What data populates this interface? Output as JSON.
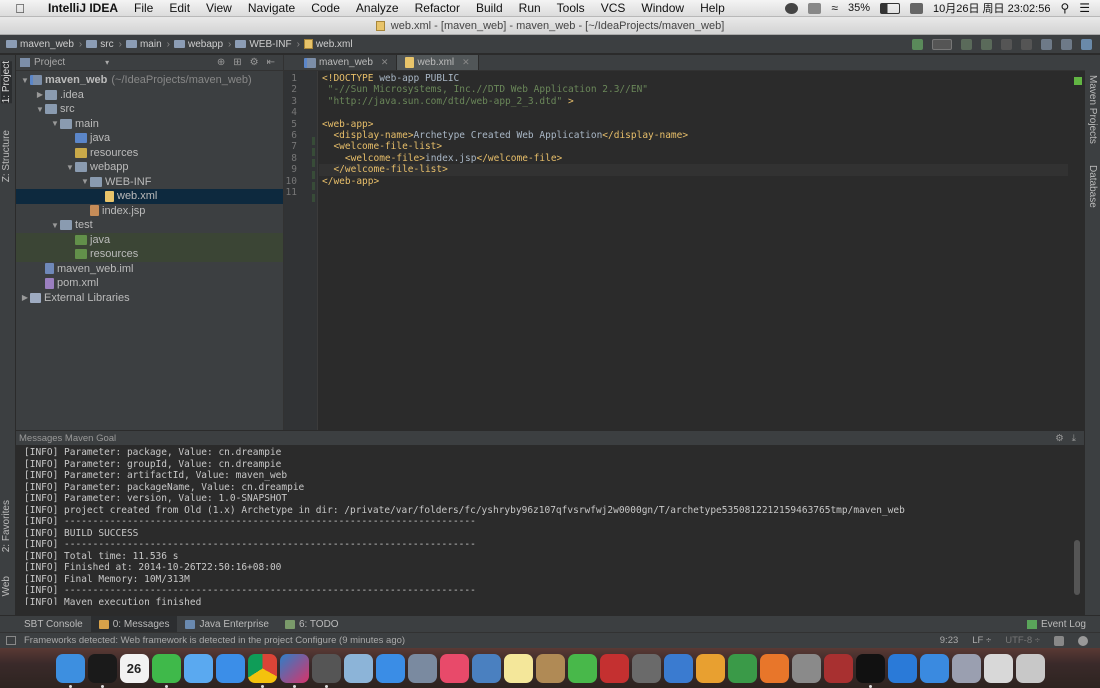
{
  "menubar": {
    "app": "IntelliJ IDEA",
    "items": [
      "File",
      "Edit",
      "View",
      "Navigate",
      "Code",
      "Analyze",
      "Refactor",
      "Build",
      "Run",
      "Tools",
      "VCS",
      "Window",
      "Help"
    ],
    "battery": "35%",
    "datetime": "10月26日 周日  23:02:56"
  },
  "window": {
    "title": "web.xml - [maven_web] - maven_web - [~/IdeaProjects/maven_web]"
  },
  "breadcrumb": [
    "maven_web",
    "src",
    "main",
    "webapp",
    "WEB-INF",
    "web.xml"
  ],
  "left_stripe": {
    "project_tab": "1: Project",
    "structure_tab": "Z: Structure",
    "favorites_tab": "2: Favorites",
    "web_tab": "Web"
  },
  "right_stripe": {
    "maven_tab": "Maven Projects",
    "database_tab": "Database"
  },
  "project_panel": {
    "title": "Project",
    "tree": [
      {
        "label": "maven_web",
        "extra": "(~/IdeaProjects/maven_web)",
        "depth": 0,
        "arrow": "▼",
        "icon": "module"
      },
      {
        "label": ".idea",
        "depth": 1,
        "arrow": "▶",
        "icon": "folder"
      },
      {
        "label": "src",
        "depth": 1,
        "arrow": "▼",
        "icon": "folder"
      },
      {
        "label": "main",
        "depth": 2,
        "arrow": "▼",
        "icon": "folder"
      },
      {
        "label": "java",
        "depth": 3,
        "arrow": "",
        "icon": "blue"
      },
      {
        "label": "resources",
        "depth": 3,
        "arrow": "",
        "icon": "yellow"
      },
      {
        "label": "webapp",
        "depth": 3,
        "arrow": "▼",
        "icon": "folder"
      },
      {
        "label": "WEB-INF",
        "depth": 4,
        "arrow": "▼",
        "icon": "folder"
      },
      {
        "label": "web.xml",
        "depth": 5,
        "arrow": "",
        "icon": "xml",
        "selected": true
      },
      {
        "label": "index.jsp",
        "depth": 4,
        "arrow": "",
        "icon": "jsp"
      },
      {
        "label": "test",
        "depth": 2,
        "arrow": "▼",
        "icon": "folder"
      },
      {
        "label": "java",
        "depth": 3,
        "arrow": "",
        "icon": "green",
        "green": true
      },
      {
        "label": "resources",
        "depth": 3,
        "arrow": "",
        "icon": "green",
        "green": true
      },
      {
        "label": "maven_web.iml",
        "depth": 1,
        "arrow": "",
        "icon": "iml"
      },
      {
        "label": "pom.xml",
        "depth": 1,
        "arrow": "",
        "icon": "pom"
      },
      {
        "label": "External Libraries",
        "depth": 0,
        "arrow": "▶",
        "icon": "lib"
      }
    ]
  },
  "editor": {
    "tabs": [
      {
        "label": "maven_web",
        "active": false
      },
      {
        "label": "web.xml",
        "active": true
      }
    ],
    "lines": [
      "<!DOCTYPE web-app PUBLIC",
      " \"-//Sun Microsystems, Inc.//DTD Web Application 2.3//EN\"",
      " \"http://java.sun.com/dtd/web-app_2_3.dtd\" >",
      "",
      "<web-app>",
      "  <display-name>Archetype Created Web Application</display-name>",
      "  <welcome-file-list>",
      "    <welcome-file>index.jsp</welcome-file>",
      "  </welcome-file-list>",
      "</web-app>",
      ""
    ],
    "current_line": 9
  },
  "messages": {
    "title": "Messages Maven Goal",
    "lines": [
      "[INFO] Parameter: package, Value: cn.dreampie",
      "[INFO] Parameter: groupId, Value: cn.dreampie",
      "[INFO] Parameter: artifactId, Value: maven_web",
      "[INFO] Parameter: packageName, Value: cn.dreampie",
      "[INFO] Parameter: version, Value: 1.0-SNAPSHOT",
      "[INFO] project created from Old (1.x) Archetype in dir: /private/var/folders/fc/yshryby96z107qfvsrwfwj2w0000gn/T/archetype5350812212159463765tmp/maven_web",
      "[INFO] ------------------------------------------------------------------------",
      "[INFO] BUILD SUCCESS",
      "[INFO] ------------------------------------------------------------------------",
      "[INFO] Total time: 11.536 s",
      "[INFO] Finished at: 2014-10-26T22:50:16+08:00",
      "[INFO] Final Memory: 10M/313M",
      "[INFO] ------------------------------------------------------------------------",
      "[INFO] Maven execution finished"
    ]
  },
  "tool_tabs": {
    "sbt": "SBT Console",
    "messages": "0: Messages",
    "java_enterprise": "Java Enterprise",
    "todo": "6: TODO",
    "event_log": "Event Log"
  },
  "status": {
    "message": "Frameworks detected: Web framework is detected in the project Configure (9 minutes ago)",
    "position": "9:23",
    "line_sep": "LF ÷",
    "encoding": "UTF-8 ÷"
  },
  "dock": {
    "calendar_day": "26",
    "apps": [
      {
        "name": "finder",
        "color": "#3d8fe0",
        "run": true
      },
      {
        "name": "qq",
        "color": "#1a1a1a",
        "run": true
      },
      {
        "name": "calendar",
        "color": "#f2f2f2",
        "run": false
      },
      {
        "name": "wechat",
        "color": "#3fb94a",
        "run": true
      },
      {
        "name": "messages",
        "color": "#5aa9f0",
        "run": false
      },
      {
        "name": "safari",
        "color": "#3b8ee8",
        "run": false
      },
      {
        "name": "chrome",
        "color": "#e0b830",
        "run": true
      },
      {
        "name": "intellij",
        "color": "#2d7fc8",
        "run": true
      },
      {
        "name": "sublime",
        "color": "#555555",
        "run": true
      },
      {
        "name": "preview",
        "color": "#8cb4d8",
        "run": false
      },
      {
        "name": "app-store",
        "color": "#3a8de6",
        "run": false
      },
      {
        "name": "launchpad",
        "color": "#7a8aa0",
        "run": false
      },
      {
        "name": "itunes",
        "color": "#e84a6a",
        "run": false
      },
      {
        "name": "xcode",
        "color": "#4a80c0",
        "run": false
      },
      {
        "name": "notes",
        "color": "#f4e79a",
        "run": false
      },
      {
        "name": "contacts",
        "color": "#b08a55",
        "run": false
      },
      {
        "name": "facetime",
        "color": "#48b84a",
        "run": false
      },
      {
        "name": "photo-booth",
        "color": "#c43030",
        "run": false
      },
      {
        "name": "photos",
        "color": "#6a6a6a",
        "run": false
      },
      {
        "name": "keynote",
        "color": "#3a7bd0",
        "run": false
      },
      {
        "name": "pages",
        "color": "#e8a030",
        "run": false
      },
      {
        "name": "numbers",
        "color": "#3a9a48",
        "run": false
      },
      {
        "name": "ibooks",
        "color": "#e8762a",
        "run": false
      },
      {
        "name": "system-preferences",
        "color": "#8a8a8a",
        "run": false
      },
      {
        "name": "dictionary",
        "color": "#a83030",
        "run": false
      },
      {
        "name": "terminal",
        "color": "#111111",
        "run": true
      },
      {
        "name": "teamviewer",
        "color": "#2a7ad8",
        "run": false
      },
      {
        "name": "xcode-fly",
        "color": "#3a8ae0",
        "run": false
      },
      {
        "name": "image-capture",
        "color": "#9a9fb0",
        "run": false
      },
      {
        "name": "documents",
        "color": "#d8d8d8",
        "run": false
      },
      {
        "name": "trash",
        "color": "#c8c8c8",
        "run": false
      }
    ]
  }
}
